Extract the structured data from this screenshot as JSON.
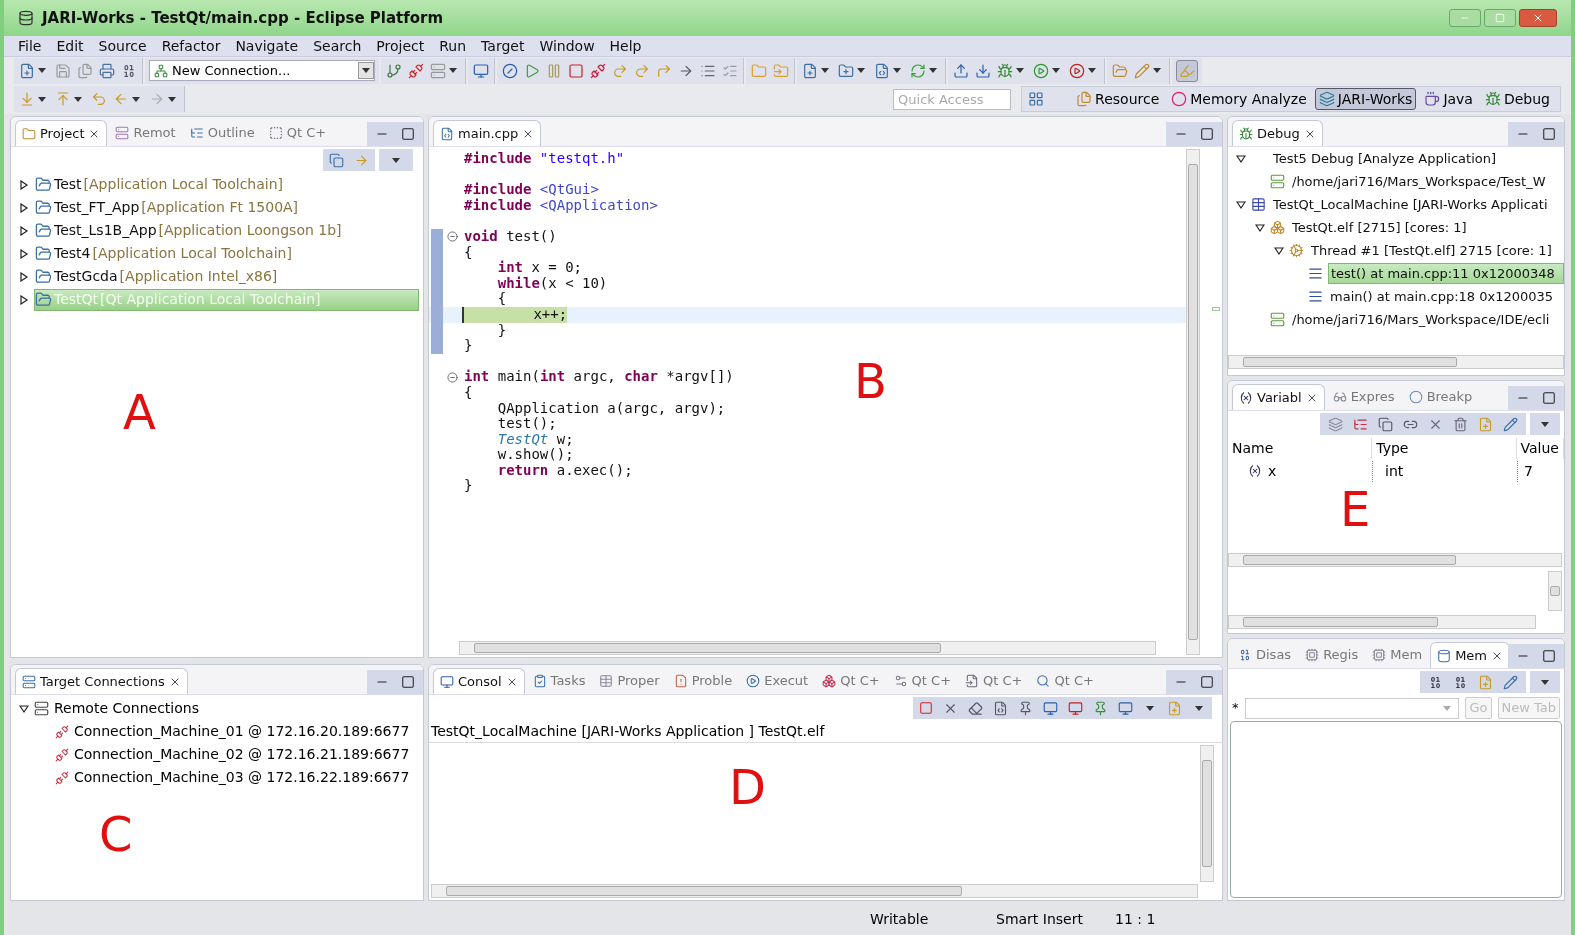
{
  "window": {
    "title": "JARI-Works - TestQt/main.cpp - Eclipse Platform"
  },
  "menu": [
    "File",
    "Edit",
    "Source",
    "Refactor",
    "Navigate",
    "Search",
    "Project",
    "Run",
    "Target",
    "Window",
    "Help"
  ],
  "toolbar": {
    "connection": "New Connection...",
    "quick_access": {
      "placeholder": "Quick Access"
    },
    "perspectives": [
      {
        "label": "Resource",
        "selected": false
      },
      {
        "label": "Memory Analyze",
        "selected": false
      },
      {
        "label": "JARI-Works",
        "selected": true
      },
      {
        "label": "Java",
        "selected": false
      },
      {
        "label": "Debug",
        "selected": false
      }
    ]
  },
  "project_panel": {
    "annotation": "A",
    "tabs": [
      {
        "label": "Project",
        "selected": true
      },
      {
        "label": "Remot",
        "selected": false
      },
      {
        "label": "Outline",
        "selected": false
      },
      {
        "label": "Qt C+",
        "selected": false
      }
    ],
    "items": [
      {
        "name": "Test",
        "detail": "[Application Local Toolchain]",
        "selected": false,
        "expanded": false
      },
      {
        "name": "Test_FT_App",
        "detail": "[Application Ft 1500A]",
        "selected": false,
        "expanded": false
      },
      {
        "name": "Test_Ls1B_App",
        "detail": "[Application Loongson 1b]",
        "selected": false,
        "expanded": false
      },
      {
        "name": "Test4",
        "detail": "[Application Local Toolchain]",
        "selected": false,
        "expanded": false
      },
      {
        "name": "TestGcda",
        "detail": "[Application Intel_x86]",
        "selected": false,
        "expanded": false
      },
      {
        "name": "TestQt",
        "detail": "[Qt Application Local Toolchain]",
        "selected": true,
        "expanded": false
      }
    ]
  },
  "editor": {
    "annotation": "B",
    "tabs": [
      {
        "label": "main.cpp",
        "selected": true
      }
    ],
    "lines": [
      {
        "segments": [
          {
            "t": "#include ",
            "kind": "directive"
          },
          {
            "t": "\"testqt.h\"",
            "kind": "string"
          }
        ]
      },
      {
        "gap_before": true,
        "segments": [
          {
            "t": "#include ",
            "kind": "directive"
          },
          {
            "t": "<QtGui>",
            "kind": "header"
          }
        ]
      },
      {
        "segments": [
          {
            "t": "#include ",
            "kind": "directive"
          },
          {
            "t": "<QApplication>",
            "kind": "header"
          }
        ]
      },
      {
        "gap_before": true,
        "fold": true,
        "range": true,
        "segments": [
          {
            "t": "void",
            "kind": "keyword"
          },
          {
            "t": " test()",
            "kind": "plain"
          }
        ]
      },
      {
        "range": true,
        "segments": [
          {
            "t": "{",
            "kind": "plain"
          }
        ]
      },
      {
        "range": true,
        "segments": [
          {
            "t": "    int",
            "kind": "keyword"
          },
          {
            "t": " x = 0;",
            "kind": "plain"
          }
        ]
      },
      {
        "range": true,
        "segments": [
          {
            "t": "    while",
            "kind": "keyword"
          },
          {
            "t": "(x < 10)",
            "kind": "plain"
          }
        ]
      },
      {
        "range": true,
        "segments": [
          {
            "t": "    {",
            "kind": "plain"
          }
        ]
      },
      {
        "range": true,
        "current": true,
        "segments": [
          {
            "t": "        x++;",
            "kind": "plain"
          }
        ]
      },
      {
        "range": true,
        "segments": [
          {
            "t": "    }",
            "kind": "plain"
          }
        ]
      },
      {
        "range": true,
        "segments": [
          {
            "t": "}",
            "kind": "plain"
          }
        ]
      },
      {
        "gap_before": true,
        "fold": true,
        "segments": [
          {
            "t": "int",
            "kind": "keyword"
          },
          {
            "t": " main(",
            "kind": "plain"
          },
          {
            "t": "int",
            "kind": "keyword"
          },
          {
            "t": " argc, ",
            "kind": "plain"
          },
          {
            "t": "char",
            "kind": "keyword"
          },
          {
            "t": " *argv[])",
            "kind": "plain"
          }
        ]
      },
      {
        "segments": [
          {
            "t": "{",
            "kind": "plain"
          }
        ]
      },
      {
        "segments": [
          {
            "t": "    QApplication a(argc, argv);",
            "kind": "plain"
          }
        ]
      },
      {
        "segments": [
          {
            "t": "    test();",
            "kind": "plain"
          }
        ]
      },
      {
        "segments": [
          {
            "t": "    TestQt",
            "kind": "type"
          },
          {
            "t": " w;",
            "kind": "plain"
          }
        ]
      },
      {
        "segments": [
          {
            "t": "    w.show();",
            "kind": "plain"
          }
        ]
      },
      {
        "segments": [
          {
            "t": "    return",
            "kind": "keyword"
          },
          {
            "t": " a.exec();",
            "kind": "plain"
          }
        ]
      },
      {
        "segments": [
          {
            "t": "}",
            "kind": "plain"
          }
        ]
      }
    ]
  },
  "debug_panel": {
    "tabs": [
      {
        "label": "Debug",
        "selected": true
      }
    ],
    "items": [
      {
        "label": "Test5 Debug [Analyze Application]",
        "kind": "launch",
        "expanded": true,
        "selected": false,
        "children": [
          {
            "label": "/home/jari716/Mars_Workspace/Test_W",
            "kind": "path",
            "selected": false
          }
        ]
      },
      {
        "label": "TestQt_LocalMachine [JARI-Works Applicati",
        "kind": "app",
        "expanded": true,
        "selected": false,
        "children": [
          {
            "label": "TestQt.elf [2715] [cores: 1]",
            "kind": "process",
            "expanded": true,
            "selected": false,
            "children": [
              {
                "label": "Thread #1 [TestQt.elf] 2715 [core: 1]",
                "kind": "thread",
                "expanded": true,
                "selected": false,
                "children": [
                  {
                    "label": "test() at main.cpp:11 0x12000348",
                    "kind": "frame",
                    "selected": true
                  },
                  {
                    "label": "main() at main.cpp:18 0x1200035",
                    "kind": "frame",
                    "selected": false
                  }
                ]
              }
            ]
          },
          {
            "label": "/home/jari716/Mars_Workspace/IDE/ecli",
            "kind": "path",
            "selected": false
          }
        ]
      }
    ]
  },
  "variables_panel": {
    "annotation": "E",
    "tabs": [
      {
        "label": "Variabl",
        "selected": true
      },
      {
        "label": "Expres",
        "selected": false
      },
      {
        "label": "Breakp",
        "selected": false
      }
    ],
    "columns": [
      "Name",
      "Type",
      "Value"
    ],
    "rows": [
      {
        "name": "x",
        "type": "int",
        "value": "7"
      }
    ]
  },
  "memory_panel": {
    "tabs": [
      {
        "label": "Disas",
        "selected": false
      },
      {
        "label": "Regis",
        "selected": false
      },
      {
        "label": "Mem",
        "selected": false
      },
      {
        "label": "Mem",
        "selected": true
      }
    ],
    "prefix": "*",
    "buttons": [
      {
        "label": "Go",
        "disabled": true
      },
      {
        "label": "New Tab",
        "disabled": true
      }
    ]
  },
  "connections_panel": {
    "annotation": "C",
    "tabs": [
      {
        "label": "Target Connections",
        "selected": true
      }
    ],
    "items": [
      {
        "label": "Remote Connections",
        "expanded": true,
        "children": [
          {
            "label": "Connection_Machine_01 @ 172.16.20.189:6677"
          },
          {
            "label": "Connection_Machine_02 @ 172.16.21.189:6677"
          },
          {
            "label": "Connection_Machine_03 @ 172.16.22.189:6677"
          }
        ]
      }
    ]
  },
  "console_panel": {
    "annotation": "D",
    "tabs": [
      {
        "label": "Consol",
        "selected": true
      },
      {
        "label": "Tasks",
        "selected": false
      },
      {
        "label": "Proper",
        "selected": false
      },
      {
        "label": "Proble",
        "selected": false
      },
      {
        "label": "Execut",
        "selected": false
      },
      {
        "label": "Qt C+",
        "selected": false
      },
      {
        "label": "Qt C+",
        "selected": false
      },
      {
        "label": "Qt C+",
        "selected": false
      },
      {
        "label": "Qt C+",
        "selected": false
      }
    ],
    "description": "TestQt_LocalMachine [JARI-Works Application ] TestQt.elf"
  },
  "status_bar": [
    "Writable",
    "Smart Insert",
    "11 : 1"
  ]
}
